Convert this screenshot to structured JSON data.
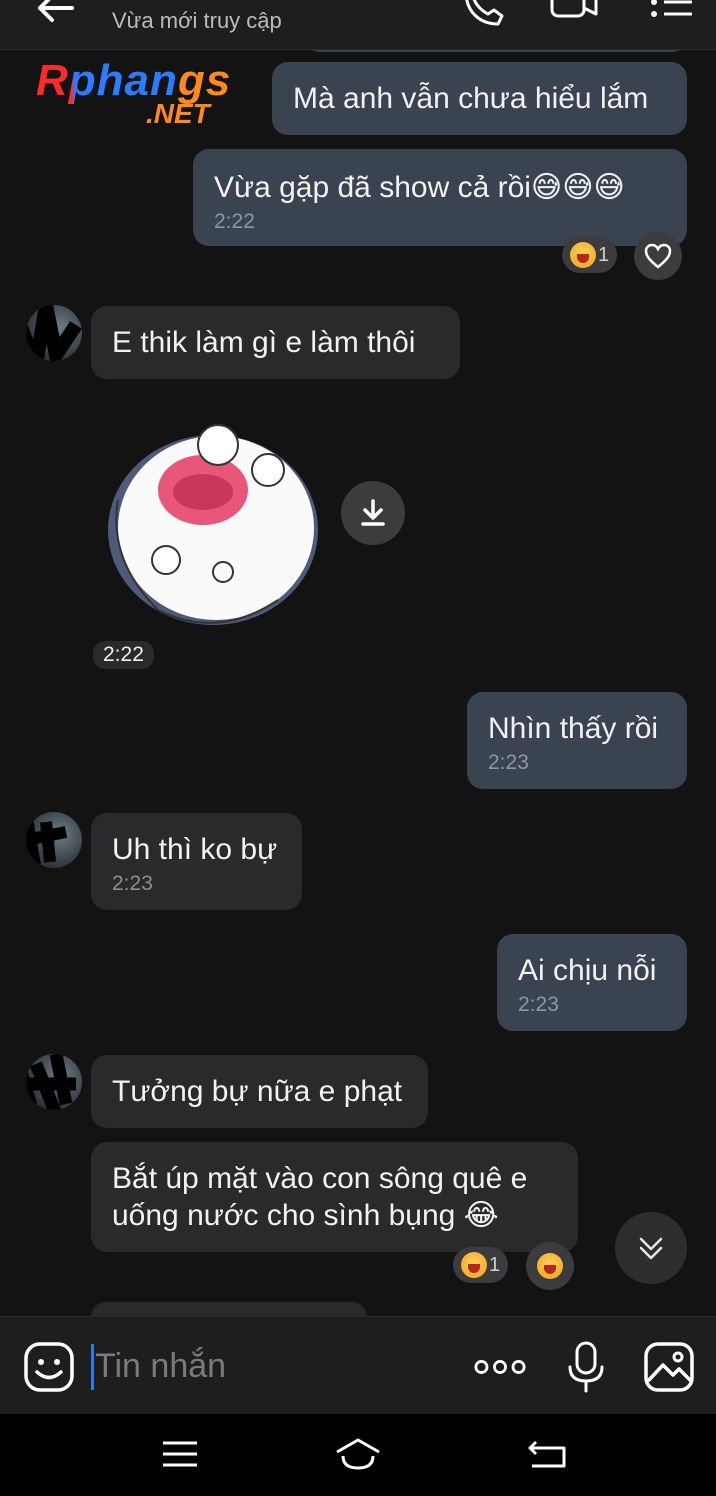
{
  "header": {
    "subtitle": "Vừa mới truy cập",
    "back_icon": "back-arrow-icon",
    "call_icon": "phone-icon",
    "video_icon": "video-icon",
    "menu_icon": "list-menu-icon"
  },
  "logo": {
    "line1": "Rphangs",
    "line2": ".NET"
  },
  "messages": [
    {
      "side": "out",
      "text": "Mà anh vẫn chưa hiểu lắm",
      "time": ""
    },
    {
      "side": "out",
      "text": "Vừa gặp đã show cả rồi😅😅😅",
      "time": "2:22",
      "reaction_count": "1"
    },
    {
      "side": "in",
      "text": "E thik làm gì e làm thôi",
      "time": ""
    },
    {
      "side": "in",
      "type": "sticker",
      "time": "2:22"
    },
    {
      "side": "out",
      "text": "Nhìn thấy rồi",
      "time": "2:23"
    },
    {
      "side": "in",
      "text": "Uh thì ko bự",
      "time": "2:23"
    },
    {
      "side": "out",
      "text": "Ai chịu nỗi",
      "time": "2:23"
    },
    {
      "side": "in",
      "text": "Tưởng bự nữa e phạt",
      "time": ""
    },
    {
      "side": "in",
      "text": "Bắt úp mặt vào con sông quê e uống nước cho sình bụng 😂",
      "time": "",
      "reaction_count": "1"
    }
  ],
  "input": {
    "placeholder": "Tin nhắn"
  },
  "colors": {
    "accent": "#2c7cf0",
    "outgoing_bubble": "#3a4350",
    "incoming_bubble": "#2a2a2c",
    "background": "#131313"
  }
}
